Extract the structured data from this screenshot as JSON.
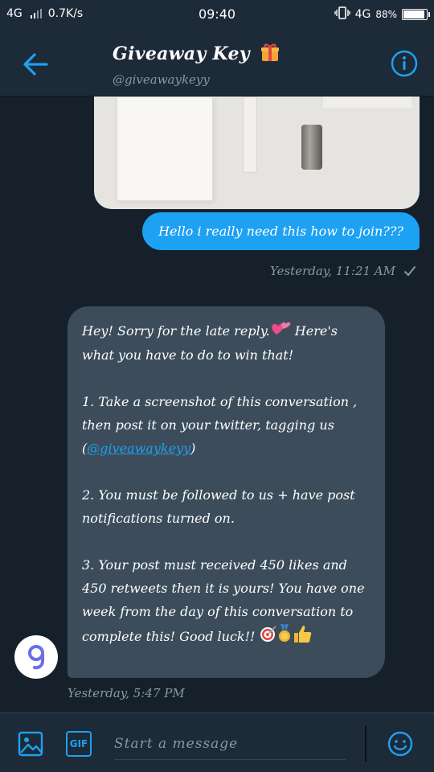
{
  "status_bar": {
    "network": "4G",
    "speed": "0.7K/s",
    "time": "09:40",
    "network_right": "4G",
    "battery": "88%",
    "battery_level": 0.88
  },
  "header": {
    "title": "Giveaway Key",
    "handle": "@giveawaykeyy",
    "icons": [
      "back-arrow-icon",
      "gift-emoji-icon",
      "info-icon"
    ]
  },
  "messages": {
    "outgoing": {
      "text": "Hello i really need this how to join???",
      "timestamp": "Yesterday, 11:21 AM",
      "status_icon": "check-icon"
    },
    "incoming": {
      "line1": "Hey! Sorry for the late reply.",
      "line1_after": " Here's what you have to do to win that!",
      "step1_pre": "1. Take a screenshot of this conversation , then post it on your twitter, tagging us (",
      "step1_mention": "@giveawaykeyy",
      "step1_post": ")",
      "step2": "2. You must be followed to us + have post notifications turned on.",
      "step3": "3. Your post must received 450 likes and 450 retweets then it is yours! You have one week from the day of this conversation to complete this! Good luck!!",
      "timestamp": "Yesterday, 5:47 PM",
      "emojis": [
        "two-hearts-emoji",
        "direct-hit-emoji",
        "medal-emoji",
        "thumbs-up-emoji"
      ]
    }
  },
  "composer": {
    "placeholder": "Start a message",
    "gif_label": "GIF"
  },
  "colors": {
    "background": "#15202b",
    "bar": "#1d2a38",
    "accent": "#1da1f2",
    "incoming_bubble": "#3c4c5b",
    "muted": "#8899a6"
  }
}
